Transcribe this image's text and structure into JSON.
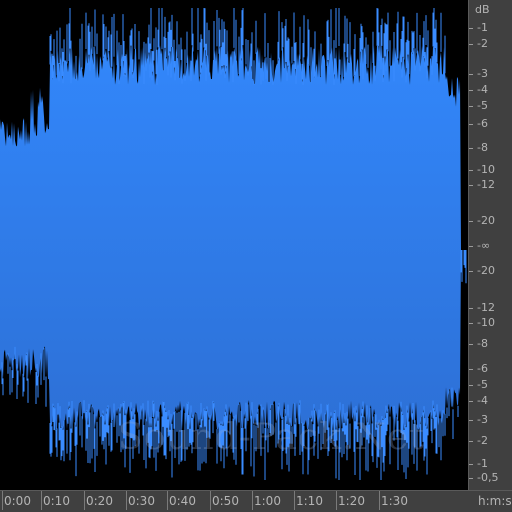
{
  "app": {
    "watermark": "Sound-Pack.Net"
  },
  "colors": {
    "waveform_top": "#3287fb",
    "waveform_bottom": "#2d70d6",
    "background": "#000000",
    "ruler_background": "#404040",
    "ruler_text": "#b4b4b4"
  },
  "db_scale": {
    "unit": "dB",
    "labels": [
      "-1",
      "-2",
      "-3",
      "-4",
      "-5",
      "-6",
      "-8",
      "-10",
      "-12",
      "-20",
      "-∞",
      "-20",
      "-12",
      "-10",
      "-8",
      "-6",
      "-5",
      "-4",
      "-3",
      "-2",
      "-1",
      "-0,5"
    ]
  },
  "time_scale": {
    "unit": "h:m:s",
    "labels": [
      "0:00",
      "0:10",
      "0:20",
      "0:30",
      "0:40",
      "0:50",
      "1:00",
      "1:10",
      "1:20",
      "1:30"
    ]
  }
}
